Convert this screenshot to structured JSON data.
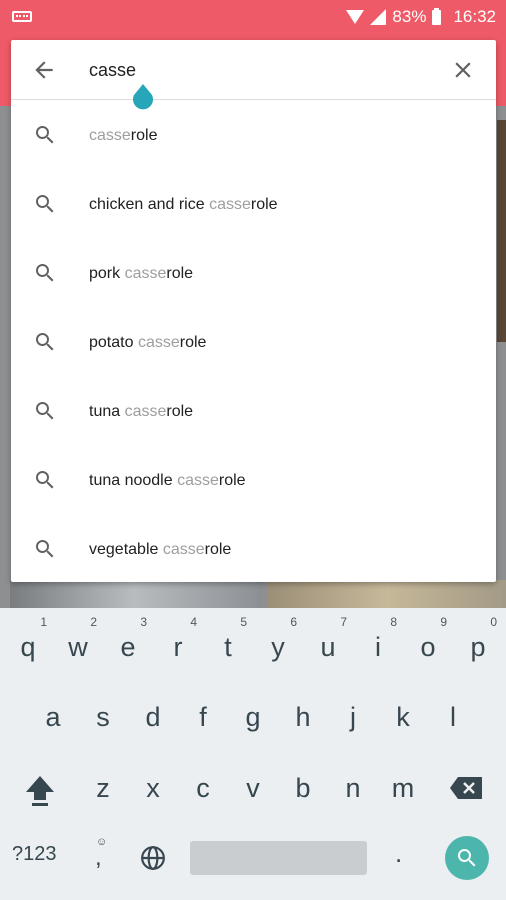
{
  "status_bar": {
    "battery": "83%",
    "time": "16:32",
    "icons": [
      "keyboard-icon",
      "wifi-icon",
      "signal-icon",
      "battery-icon"
    ]
  },
  "search": {
    "query": "casse",
    "back_icon": "arrow-back-icon",
    "clear_icon": "close-icon"
  },
  "suggestions": [
    {
      "pre": "",
      "match": "casse",
      "post": "role"
    },
    {
      "pre": "chicken and rice ",
      "match": "casse",
      "post": "role"
    },
    {
      "pre": "pork ",
      "match": "casse",
      "post": "role"
    },
    {
      "pre": "potato ",
      "match": "casse",
      "post": "role"
    },
    {
      "pre": "tuna ",
      "match": "casse",
      "post": "role"
    },
    {
      "pre": "tuna noodle ",
      "match": "casse",
      "post": "role"
    },
    {
      "pre": "vegetable ",
      "match": "casse",
      "post": "role"
    }
  ],
  "keyboard": {
    "row1": [
      {
        "k": "q",
        "h": "1"
      },
      {
        "k": "w",
        "h": "2"
      },
      {
        "k": "e",
        "h": "3"
      },
      {
        "k": "r",
        "h": "4"
      },
      {
        "k": "t",
        "h": "5"
      },
      {
        "k": "y",
        "h": "6"
      },
      {
        "k": "u",
        "h": "7"
      },
      {
        "k": "i",
        "h": "8"
      },
      {
        "k": "o",
        "h": "9"
      },
      {
        "k": "p",
        "h": "0"
      }
    ],
    "row2": [
      "a",
      "s",
      "d",
      "f",
      "g",
      "h",
      "j",
      "k",
      "l"
    ],
    "row3": [
      "z",
      "x",
      "c",
      "v",
      "b",
      "n",
      "m"
    ],
    "symbols_label": "?123",
    "comma": ",",
    "period": ".",
    "accent_color": "#4db6ac"
  },
  "colors": {
    "app_bar": "#ee5a67",
    "keyboard_bg": "#eceff1"
  }
}
